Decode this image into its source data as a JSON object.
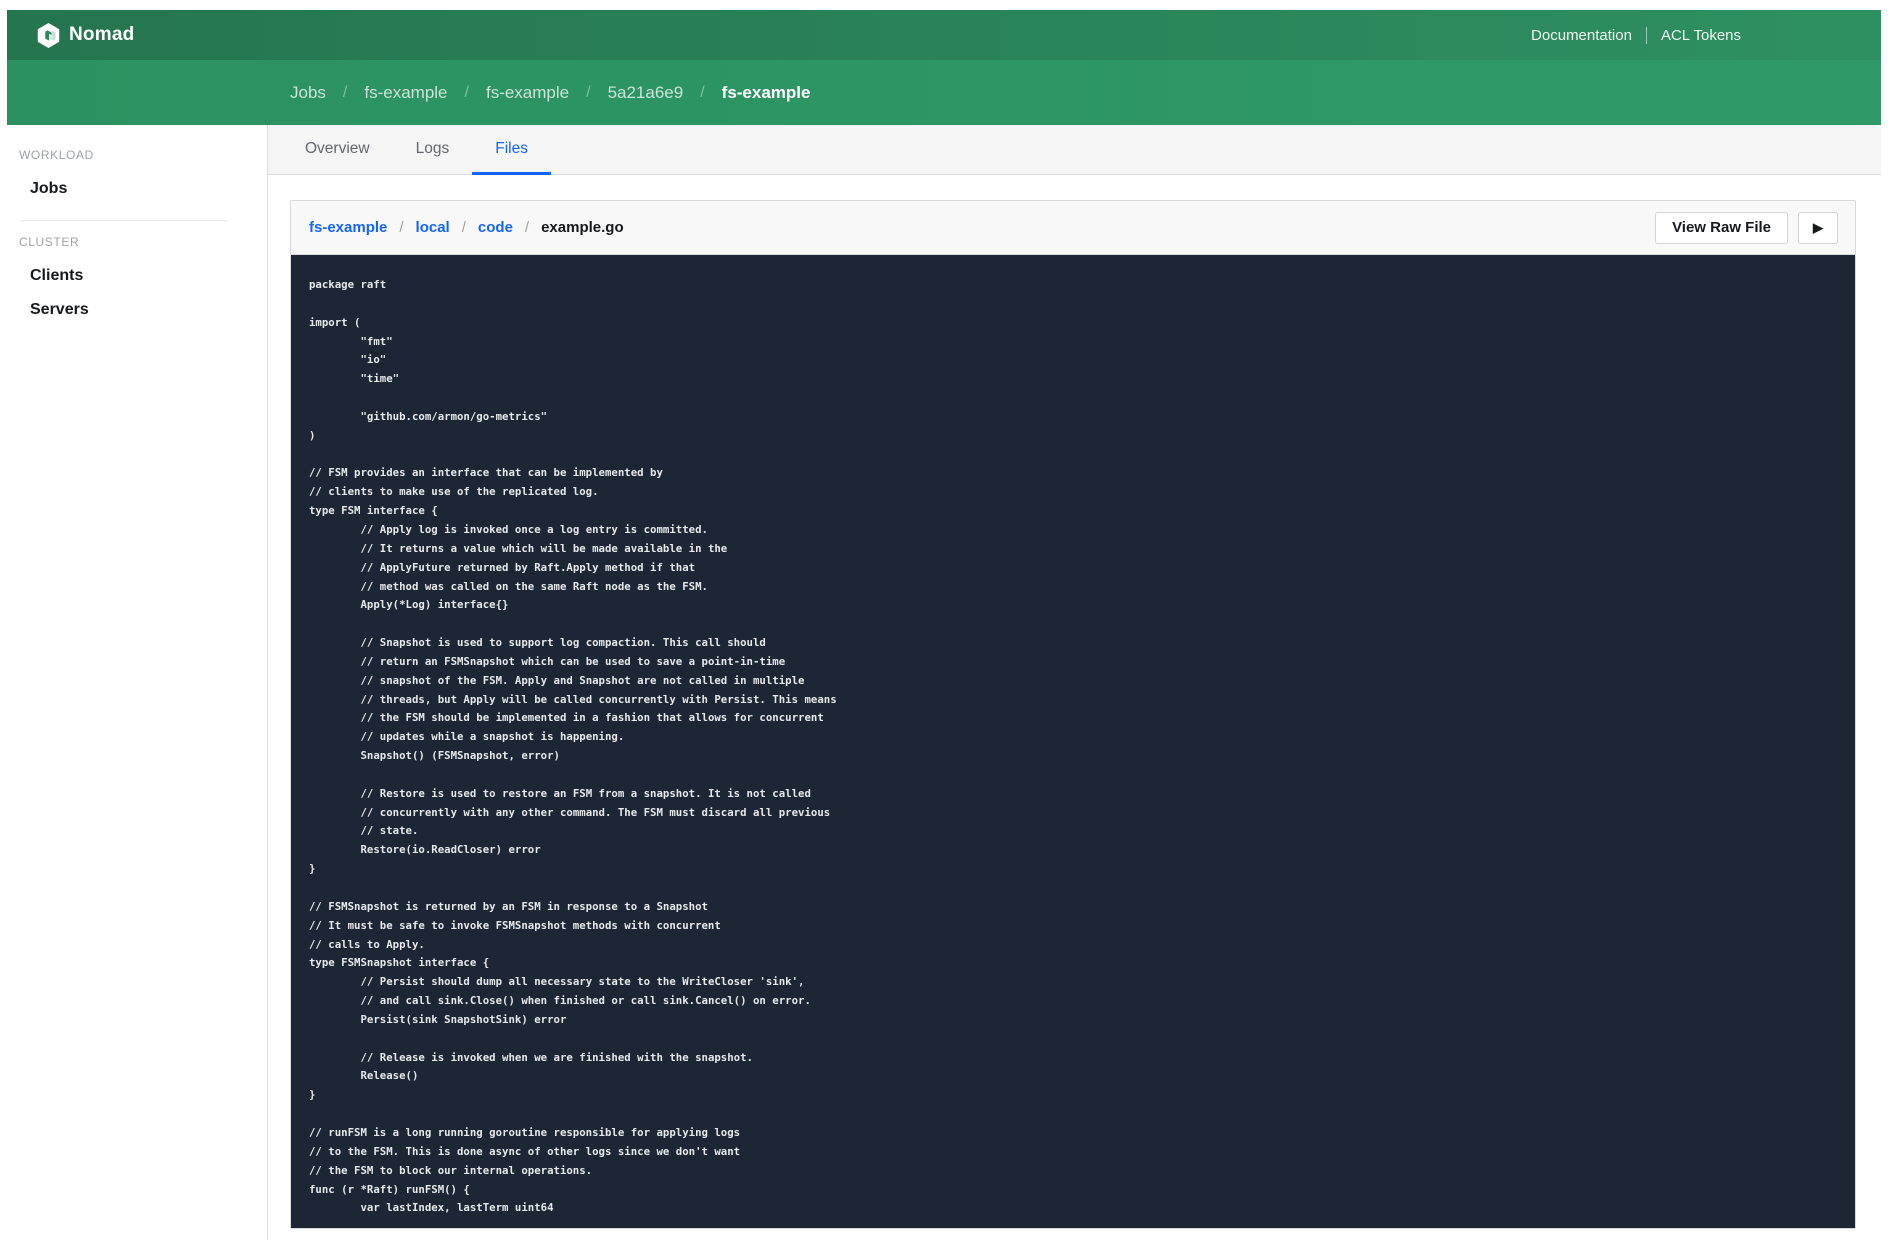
{
  "nav": {
    "brand": "Nomad",
    "links": [
      {
        "label": "Documentation"
      },
      {
        "label": "ACL Tokens"
      }
    ]
  },
  "breadcrumbs": {
    "separator": "/",
    "items": [
      "Jobs",
      "fs-example",
      "fs-example",
      "5a21a6e9"
    ],
    "current": "fs-example"
  },
  "tabs": [
    {
      "label": "Overview",
      "active": false
    },
    {
      "label": "Logs",
      "active": false
    },
    {
      "label": "Files",
      "active": true
    }
  ],
  "sidebar": {
    "sections": [
      {
        "label": "Workload",
        "items": [
          {
            "label": "Jobs"
          }
        ]
      },
      {
        "label": "Cluster",
        "items": [
          {
            "label": "Clients"
          },
          {
            "label": "Servers"
          }
        ]
      }
    ]
  },
  "file_browser": {
    "separator": "/",
    "path_links": [
      "fs-example",
      "local",
      "code"
    ],
    "file_name": "example.go",
    "view_raw_label": "View Raw File",
    "follow_icon": "▶"
  },
  "code": {
    "file_language": "go",
    "content": "package raft\n\nimport (\n\t\"fmt\"\n\t\"io\"\n\t\"time\"\n\n\t\"github.com/armon/go-metrics\"\n)\n\n// FSM provides an interface that can be implemented by\n// clients to make use of the replicated log.\ntype FSM interface {\n\t// Apply log is invoked once a log entry is committed.\n\t// It returns a value which will be made available in the\n\t// ApplyFuture returned by Raft.Apply method if that\n\t// method was called on the same Raft node as the FSM.\n\tApply(*Log) interface{}\n\n\t// Snapshot is used to support log compaction. This call should\n\t// return an FSMSnapshot which can be used to save a point-in-time\n\t// snapshot of the FSM. Apply and Snapshot are not called in multiple\n\t// threads, but Apply will be called concurrently with Persist. This means\n\t// the FSM should be implemented in a fashion that allows for concurrent\n\t// updates while a snapshot is happening.\n\tSnapshot() (FSMSnapshot, error)\n\n\t// Restore is used to restore an FSM from a snapshot. It is not called\n\t// concurrently with any other command. The FSM must discard all previous\n\t// state.\n\tRestore(io.ReadCloser) error\n}\n\n// FSMSnapshot is returned by an FSM in response to a Snapshot\n// It must be safe to invoke FSMSnapshot methods with concurrent\n// calls to Apply.\ntype FSMSnapshot interface {\n\t// Persist should dump all necessary state to the WriteCloser 'sink',\n\t// and call sink.Close() when finished or call sink.Cancel() on error.\n\tPersist(sink SnapshotSink) error\n\n\t// Release is invoked when we are finished with the snapshot.\n\tRelease()\n}\n\n// runFSM is a long running goroutine responsible for applying logs\n// to the FSM. This is done async of other logs since we don't want\n// the FSM to block our internal operations.\nfunc (r *Raft) runFSM() {\n\tvar lastIndex, lastTerm uint64"
  },
  "colors": {
    "header_top": "#25754f",
    "header_top_right": "#2e9061",
    "header_sub": "#2b9160",
    "header_sub_right": "#2f9a68",
    "accent_blue": "#1563ff",
    "code_bg": "#1c2634",
    "code_text": "#e7e9ec",
    "panel_header_bg": "#f8f8f9",
    "tabbar_bg": "#f5f5f6",
    "border": "#d9dadc",
    "text_dark": "#17191c",
    "text_gray": "#63666c",
    "label_gray": "#9ea1a6"
  }
}
